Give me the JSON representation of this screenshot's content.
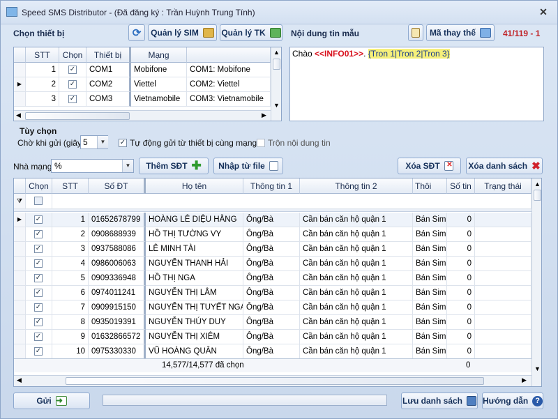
{
  "window": {
    "title": "Speed SMS Distributor - (Đã đăng ký : Trần Huỳnh Trung Tính)"
  },
  "devices": {
    "section_label": "Chọn thiết bị",
    "sim_button": "Quản lý SIM",
    "tk_button": "Quản lý TK",
    "columns": [
      "STT",
      "Chọn",
      "Thiết bị",
      "Mạng",
      ""
    ],
    "rows": [
      {
        "stt": "1",
        "device": "COM1",
        "network": "Mobifone",
        "desc": "COM1: Mobifone"
      },
      {
        "stt": "2",
        "device": "COM2",
        "network": "Viettel",
        "desc": "COM2: Viettel"
      },
      {
        "stt": "3",
        "device": "COM3",
        "network": "Vietnamobile",
        "desc": "COM3: Vietnamobile"
      }
    ]
  },
  "message": {
    "section_label": "Nội dung tin mẫu",
    "code_button": "Mã thay thế",
    "counter": "41/119 - 1",
    "text_prefix": "Chào ",
    "text_tag": "<<INFO01>>",
    "text_mid": ". ",
    "text_spin": "{Tron 1|Tron 2|Tron 3}"
  },
  "options": {
    "title": "Tùy chọn",
    "wait_label": "Chờ khi gửi (giây)",
    "wait_value": "5",
    "auto_send_label": "Tự động gửi từ thiết bị cùng mạng",
    "mix_label": "Trộn nội dung tin"
  },
  "filters": {
    "network_label": "Nhà mạng",
    "network_value": "%",
    "add_button": "Thêm SĐT",
    "import_button": "Nhập từ file",
    "delete_button": "Xóa SĐT",
    "clear_button": "Xóa danh sách"
  },
  "contacts": {
    "columns": [
      "Chọn",
      "STT",
      "Số ĐT",
      "Họ tên",
      "Thông tin 1",
      "Thông tin 2",
      "Thôi",
      "Số tin",
      "Trạng thái"
    ],
    "rows": [
      {
        "stt": "1",
        "phone": "01652678799",
        "name": "HOÀNG LÊ DIỆU HẰNG",
        "info1": "Ông/Bà",
        "info2": "Cần bán căn hộ quận 1",
        "info3": "Bán Sim",
        "count": "0"
      },
      {
        "stt": "2",
        "phone": "0908688939",
        "name": "HỒ THỊ TƯỜNG VY",
        "info1": "Ông/Bà",
        "info2": "Cần bán căn hộ quận 1",
        "info3": "Bán Sim",
        "count": "0"
      },
      {
        "stt": "3",
        "phone": "0937588086",
        "name": "LÊ MINH TÀI",
        "info1": "Ông/Bà",
        "info2": "Cần bán căn hộ quận 1",
        "info3": "Bán Sim",
        "count": "0"
      },
      {
        "stt": "4",
        "phone": "0986006063",
        "name": "NGUYỄN THANH HẢI",
        "info1": "Ông/Bà",
        "info2": "Cần bán căn hộ quận 1",
        "info3": "Bán Sim",
        "count": "0"
      },
      {
        "stt": "5",
        "phone": "0909336948",
        "name": "HỒ THỊ NGA",
        "info1": "Ông/Bà",
        "info2": "Cần bán căn hộ quận 1",
        "info3": "Bán Sim",
        "count": "0"
      },
      {
        "stt": "6",
        "phone": "0974011241",
        "name": "NGUYỄN THỊ LÂM",
        "info1": "Ông/Bà",
        "info2": "Cần bán căn hộ quận 1",
        "info3": "Bán Sim",
        "count": "0"
      },
      {
        "stt": "7",
        "phone": "0909915150",
        "name": "NGUYỄN THỊ TUYẾT NGA",
        "info1": "Ông/Bà",
        "info2": "Cần bán căn hộ quận 1",
        "info3": "Bán Sim",
        "count": "0"
      },
      {
        "stt": "8",
        "phone": "0935019391",
        "name": "NGUYỄN THÚY DUY",
        "info1": "Ông/Bà",
        "info2": "Cần bán căn hộ quận 1",
        "info3": "Bán Sim",
        "count": "0"
      },
      {
        "stt": "9",
        "phone": "01632866572",
        "name": "NGUYỄN THỊ XIÊM",
        "info1": "Ông/Bà",
        "info2": "Cần bán căn hộ quận 1",
        "info3": "Bán Sim",
        "count": "0"
      },
      {
        "stt": "10",
        "phone": "0975330330",
        "name": "VŨ HOÀNG QUÂN",
        "info1": "Ông/Bà",
        "info2": "Cần bán căn hộ quận 1",
        "info3": "Bán Sim",
        "count": "0"
      }
    ],
    "footer_selected": "14,577/14,577 đã chọn",
    "footer_count": "0"
  },
  "bottom": {
    "send_button": "Gửi",
    "save_button": "Lưu danh sách",
    "help_button": "Hướng dẫn",
    "progress": 0
  },
  "colors": {
    "accent": "#15305a",
    "counter": "#c0262a",
    "tag": "#d8101c",
    "spin_bg": "#f6f07a"
  }
}
